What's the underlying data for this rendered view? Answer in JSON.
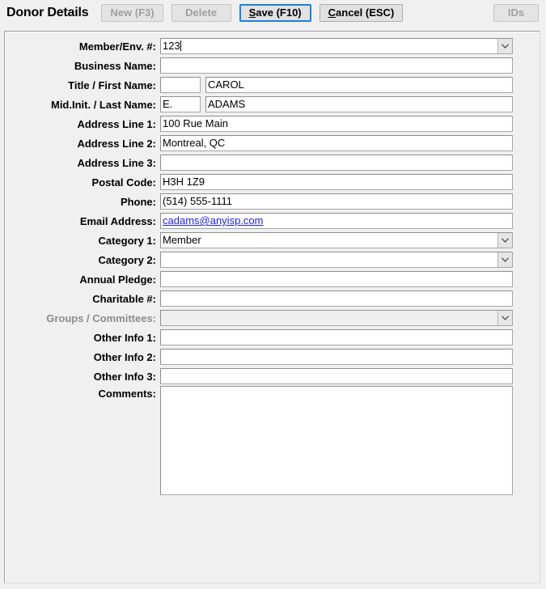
{
  "header": {
    "title": "Donor Details",
    "buttons": [
      {
        "name": "new",
        "label": "New (F3)",
        "accel": "",
        "disabled": true,
        "focused": false
      },
      {
        "name": "delete",
        "label": "Delete",
        "accel": "",
        "disabled": true,
        "focused": false
      },
      {
        "name": "save",
        "label": "Save (F10)",
        "accel": "S",
        "disabled": false,
        "focused": true
      },
      {
        "name": "cancel",
        "label": "Cancel (ESC)",
        "accel": "C",
        "disabled": false,
        "focused": false
      },
      {
        "name": "ids",
        "label": "IDs",
        "accel": "",
        "disabled": true,
        "focused": false
      }
    ],
    "save_label_pre": "S",
    "save_label_post": "ave (F10)",
    "cancel_label_pre": "C",
    "cancel_label_post": "ancel (ESC)",
    "new_label": "New (F3)",
    "delete_label": "Delete",
    "ids_label": "IDs"
  },
  "form": {
    "member_number": {
      "label": "Member/Env. #:",
      "value": "123",
      "placeholder": ""
    },
    "business_name": {
      "label": "Business Name:",
      "value": "",
      "placeholder": ""
    },
    "title_first_name": {
      "label": "Title / First Name:",
      "title_value": "",
      "first_name_value": "CAROL",
      "placeholder": ""
    },
    "mid_last_name": {
      "label": "Mid.Init. / Last Name:",
      "mid_initial_value": "E.",
      "last_name_value": "ADAMS",
      "placeholder": ""
    },
    "address_line_1": {
      "label": "Address Line 1:",
      "value": "100 Rue Main",
      "placeholder": ""
    },
    "address_line_2": {
      "label": "Address Line 2:",
      "value": "Montreal, QC",
      "placeholder": ""
    },
    "address_line_3": {
      "label": "Address Line 3:",
      "value": "",
      "placeholder": ""
    },
    "postal_code": {
      "label": "Postal Code:",
      "value": "H3H 1Z9",
      "placeholder": ""
    },
    "phone": {
      "label": "Phone:",
      "value": "(514) 555-1111",
      "placeholder": ""
    },
    "email": {
      "label": "Email Address:",
      "value": "cadams@anyisp.com",
      "placeholder": ""
    },
    "category_1": {
      "label": "Category 1:",
      "value": "Member",
      "placeholder": ""
    },
    "category_2": {
      "label": "Category 2:",
      "value": "",
      "placeholder": ""
    },
    "annual_pledge": {
      "label": "Annual Pledge:",
      "value": "",
      "placeholder": ""
    },
    "charitable_number": {
      "label": "Charitable #:",
      "value": "",
      "placeholder": ""
    },
    "groups_committees": {
      "label": "Groups / Committees:",
      "value": "",
      "placeholder": ""
    },
    "other_info_1": {
      "label": "Other Info 1:",
      "value": "",
      "placeholder": ""
    },
    "other_info_2": {
      "label": "Other Info 2:",
      "value": "",
      "placeholder": ""
    },
    "other_info_3": {
      "label": "Other Info 3:",
      "value": "",
      "placeholder": ""
    },
    "comments": {
      "label": "Comments:",
      "value": "",
      "placeholder": ""
    }
  },
  "colors": {
    "window_background": "#f0f0f0",
    "field_background": "#ffffff",
    "field_border": "#a6a6a6",
    "disabled_text": "#8d8d8d",
    "link_text": "#2222dd",
    "focus_ring": "#1a7fe8",
    "button_face": "#e1e1e1"
  },
  "icons": {
    "chevron_down": "chevron-down-icon"
  }
}
